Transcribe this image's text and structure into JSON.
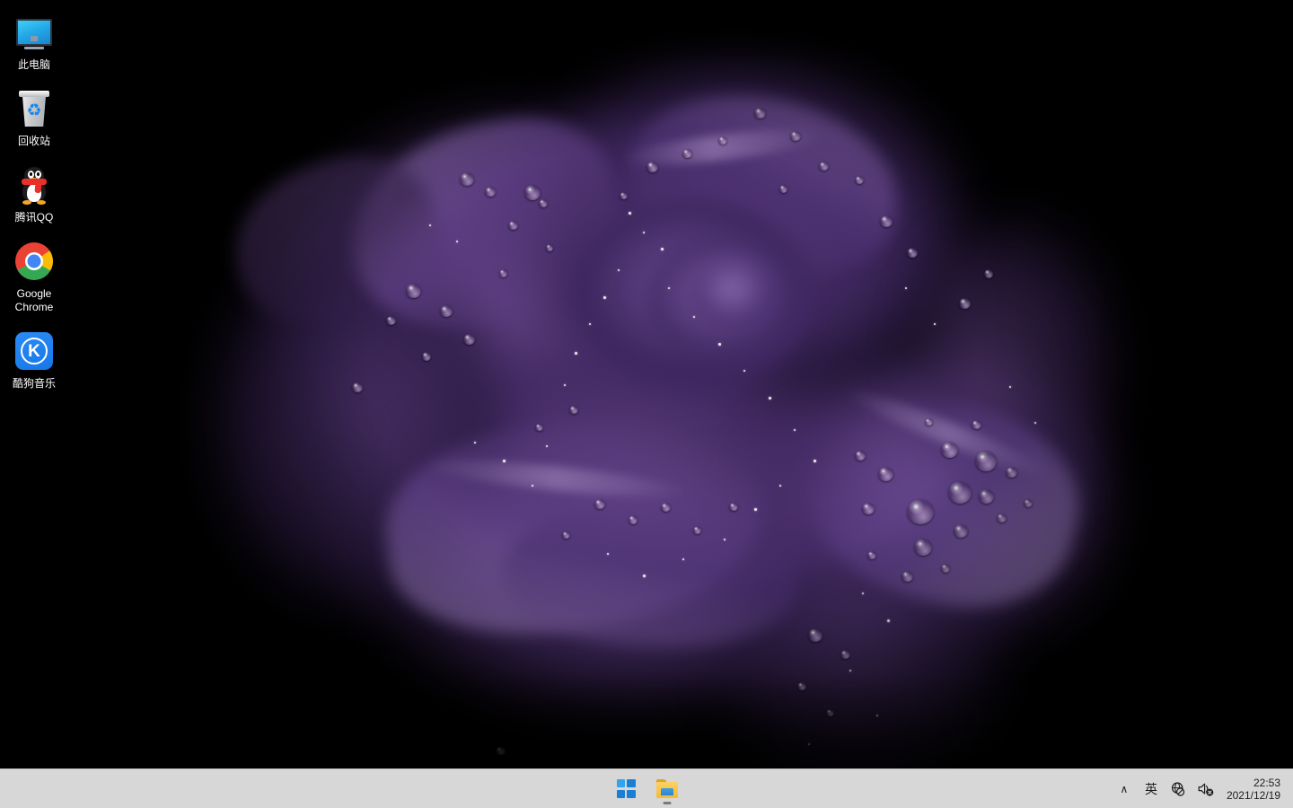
{
  "desktop": {
    "wallpaper": {
      "subject": "purple rose with water droplets",
      "background_color": "#000000",
      "petal_color": "#4a2d6b",
      "petal_highlight_color": "#9b7bb8",
      "droplet_highlight_color": "#ffffff"
    },
    "icons": [
      {
        "id": "this-pc",
        "label": "此电脑",
        "icon": "monitor-icon"
      },
      {
        "id": "recycle-bin",
        "label": "回收站",
        "icon": "recycle-bin-icon"
      },
      {
        "id": "tencent-qq",
        "label": "腾讯QQ",
        "icon": "qq-penguin-icon"
      },
      {
        "id": "google-chrome",
        "label": "Google Chrome",
        "icon": "chrome-icon"
      },
      {
        "id": "kugou-music",
        "label": "酷狗音乐",
        "icon": "kugou-music-icon"
      }
    ]
  },
  "taskbar": {
    "background_color": "#d7d7d7",
    "buttons": [
      {
        "id": "start",
        "label": "开始",
        "icon": "windows-logo-icon",
        "running": false
      },
      {
        "id": "file-explorer",
        "label": "文件资源管理器",
        "icon": "folder-icon",
        "running": true
      }
    ],
    "tray": {
      "overflow_label": "∧",
      "ime_label": "英",
      "network_label": "网络 - 未连接",
      "network_icon": "globe-disconnected-icon",
      "volume_label": "已静音",
      "volume_icon": "speaker-muted-icon",
      "clock": {
        "time": "22:53",
        "date": "2021/12/19"
      }
    }
  }
}
